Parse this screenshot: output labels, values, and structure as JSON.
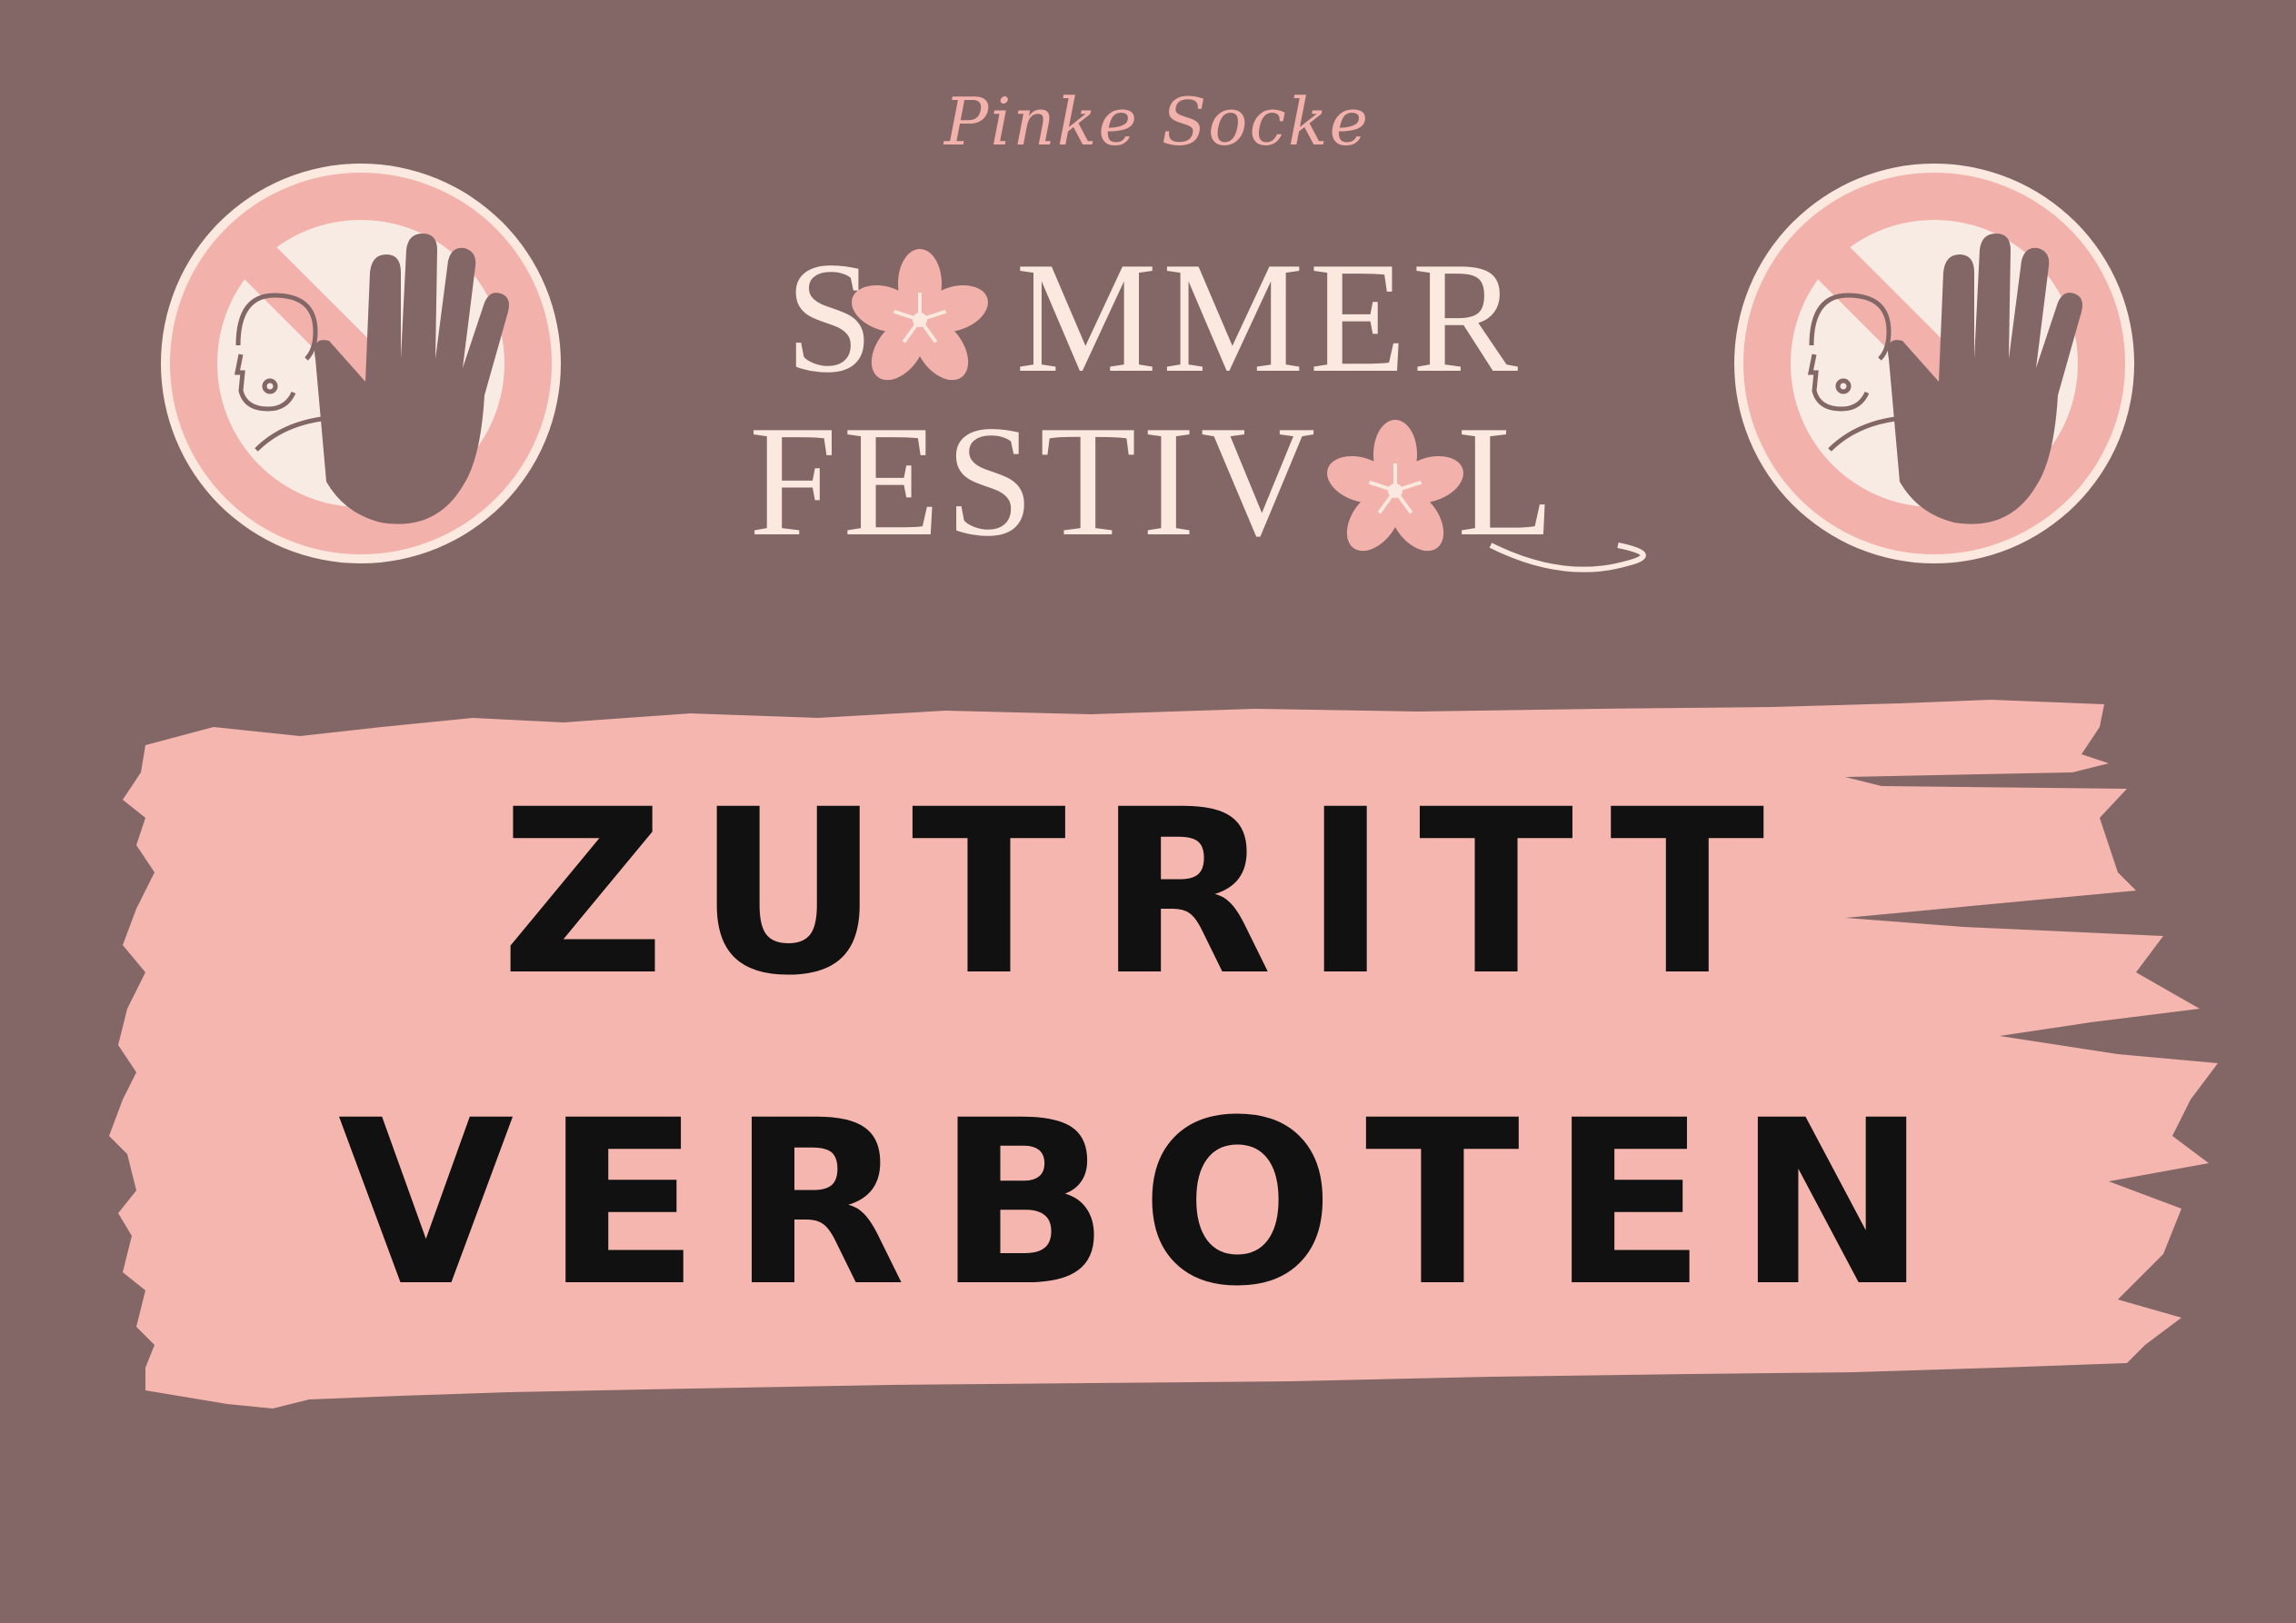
{
  "brand_title": "Pinke Socke",
  "festival_line1": {
    "before": "S",
    "after": "MMER"
  },
  "festival_line2": {
    "before": "FESTIV",
    "after": "L"
  },
  "headline_line1": "ZUTRITT",
  "headline_line2": "VERBOTEN",
  "icons": {
    "left": "no-entry-hand-icon",
    "right": "no-entry-hand-icon",
    "flower1": "flower-icon",
    "flower2": "flower-icon"
  },
  "colors": {
    "background": "#836767",
    "banner_pink": "#f4b6ae",
    "sign_outer": "#fbe9df",
    "sign_ring": "#f3b1ab",
    "sign_inner": "#f8ebe3",
    "hand": "#836767",
    "festival_text": "#fbe9df",
    "headline_text": "#111111"
  }
}
